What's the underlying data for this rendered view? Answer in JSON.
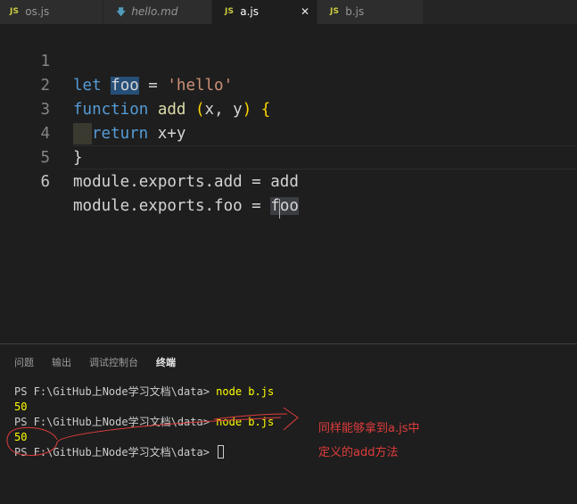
{
  "tabs": [
    {
      "icon": "JS",
      "label": "os.js",
      "active": false
    },
    {
      "icon": "md-arrow",
      "label": "hello.md",
      "active": false
    },
    {
      "icon": "JS",
      "label": "a.js",
      "active": true,
      "close": "✕"
    },
    {
      "icon": "JS",
      "label": "b.js",
      "active": false
    }
  ],
  "editor": {
    "line_numbers": [
      "1",
      "2",
      "3",
      "4",
      "5",
      "6"
    ],
    "current_line": 6,
    "code": {
      "l1_kw": "let",
      "l1_var": "foo",
      "l1_eq": " = ",
      "l1_str": "'hello'",
      "l2_kw": "function",
      "l2_fn": " add ",
      "l2_open": "(",
      "l2_params": "x, y",
      "l2_close": ")",
      "l2_brace": " {",
      "l3_kw": "return",
      "l3_expr": " x+y",
      "l4": "}",
      "l5": "module.exports.add = add",
      "l6_pre": "module.exports.foo = ",
      "l6_f": "f",
      "l6_oo": "oo"
    }
  },
  "panel": {
    "tabs": [
      "问题",
      "输出",
      "调试控制台",
      "终端"
    ],
    "active_tab": "终端",
    "terminal": [
      {
        "prompt": "PS F:\\GitHub上Node学习文档\\data> ",
        "cmd": "node b.js"
      },
      {
        "output": "50"
      },
      {
        "prompt": "PS F:\\GitHub上Node学习文档\\data> ",
        "cmd": "node b.js"
      },
      {
        "output": "50"
      },
      {
        "prompt": "PS F:\\GitHub上Node学习文档\\data> ",
        "cmd": ""
      }
    ]
  },
  "annotation": {
    "line1": "同样能够拿到a.js中",
    "line2": "定义的add方法",
    "color": "#e03c3c"
  }
}
